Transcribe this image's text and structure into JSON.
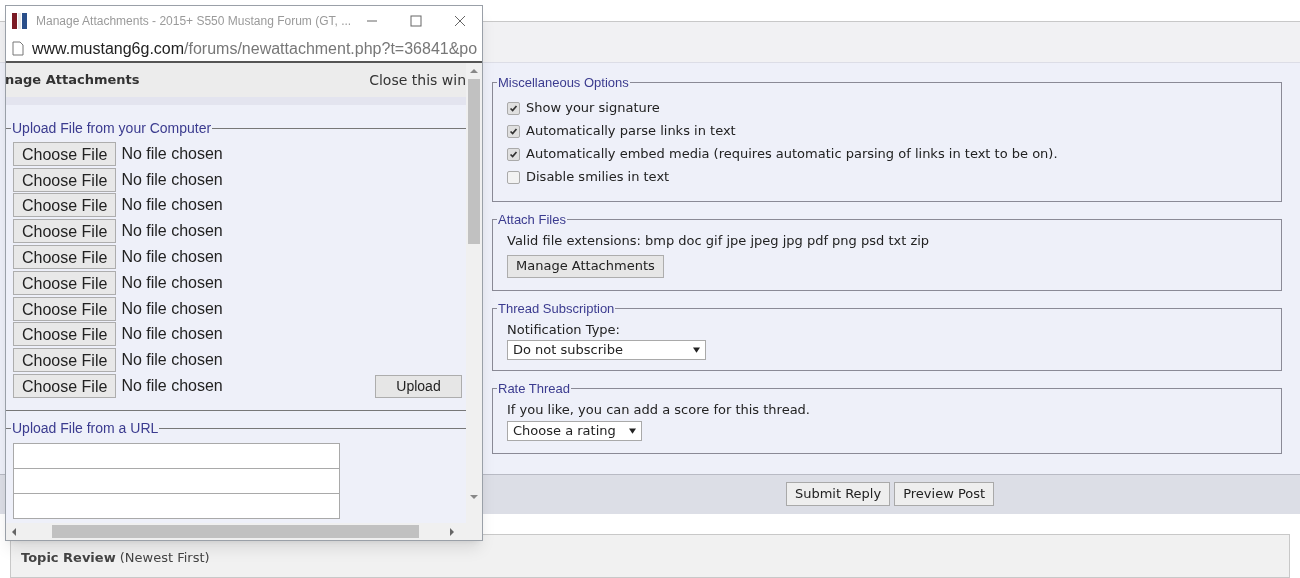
{
  "popup": {
    "title": "Manage Attachments - 2015+ S550 Mustang Forum (GT, ...",
    "url_domain": "www.mustang6g.com",
    "url_path": "/forums/newattachment.php?t=36841&po",
    "header_title": "nage Attachments",
    "close_link": "Close this win",
    "computer_section": {
      "legend": "Upload File from your Computer",
      "files": [
        {
          "button": "Choose File",
          "status": "No file chosen"
        },
        {
          "button": "Choose File",
          "status": "No file chosen"
        },
        {
          "button": "Choose File",
          "status": "No file chosen"
        },
        {
          "button": "Choose File",
          "status": "No file chosen"
        },
        {
          "button": "Choose File",
          "status": "No file chosen"
        },
        {
          "button": "Choose File",
          "status": "No file chosen"
        },
        {
          "button": "Choose File",
          "status": "No file chosen"
        },
        {
          "button": "Choose File",
          "status": "No file chosen"
        },
        {
          "button": "Choose File",
          "status": "No file chosen"
        },
        {
          "button": "Choose File",
          "status": "No file chosen"
        }
      ],
      "upload_button": "Upload"
    },
    "url_section": {
      "legend": "Upload File from a URL",
      "fields": [
        {
          "kind": "input"
        },
        {
          "kind": "input"
        },
        {
          "kind": "input"
        }
      ]
    }
  },
  "misc_options": {
    "legend": "Miscellaneous Options",
    "options": [
      {
        "label": "Show your signature",
        "checked": true
      },
      {
        "label": "Automatically parse links in text",
        "checked": true
      },
      {
        "label": "Automatically embed media (requires automatic parsing of links in text to be on).",
        "checked": true
      },
      {
        "label": "Disable smilies in text",
        "checked": false
      }
    ]
  },
  "attach_files": {
    "legend": "Attach Files",
    "extensions": "Valid file extensions: bmp doc gif jpe jpeg jpg pdf png psd txt zip",
    "button": "Manage Attachments"
  },
  "thread_subscription": {
    "legend": "Thread Subscription",
    "label": "Notification Type:",
    "select": "Do not subscribe"
  },
  "rate_thread": {
    "legend": "Rate Thread",
    "text": "If you like, you can add a score for this thread.",
    "select": "Choose a rating"
  },
  "buttons": [
    "Submit Reply",
    "Preview Post"
  ],
  "topic_review": "**Topic Review** (Newest First)"
}
